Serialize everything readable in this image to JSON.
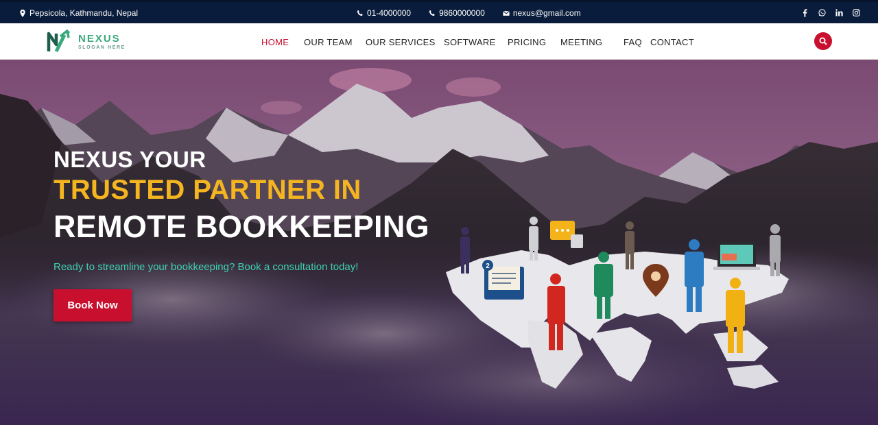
{
  "topbar": {
    "location": "Pepsicola, Kathmandu, Nepal",
    "phone1": "01-4000000",
    "phone2": "9860000000",
    "email": "nexus@gmail.com",
    "socials": [
      "facebook-icon",
      "whatsapp-icon",
      "linkedin-icon",
      "instagram-icon"
    ]
  },
  "logo": {
    "name": "NEXUS",
    "slogan": "SLOGAN HERE"
  },
  "nav": {
    "items": [
      {
        "label": "HOME",
        "active": true
      },
      {
        "label": "OUR TEAM"
      },
      {
        "label": "OUR SERVICES"
      },
      {
        "label": "SOFTWARE"
      },
      {
        "label": "PRICING"
      },
      {
        "label": "MEETING"
      },
      {
        "label": "FAQ"
      },
      {
        "label": "CONTACT"
      }
    ]
  },
  "hero": {
    "line1": "NEXUS YOUR",
    "line2": "TRUSTED PARTNER IN",
    "line3": "REMOTE BOOKKEEPING",
    "subtitle": "Ready to streamline your bookkeeping? Book a consultation today!",
    "cta": "Book Now",
    "notification_count": "2"
  },
  "colors": {
    "topbar": "#0a1c3b",
    "accent": "#c8102e",
    "highlight": "#f5b521",
    "subtitle": "#3fd1b0"
  }
}
